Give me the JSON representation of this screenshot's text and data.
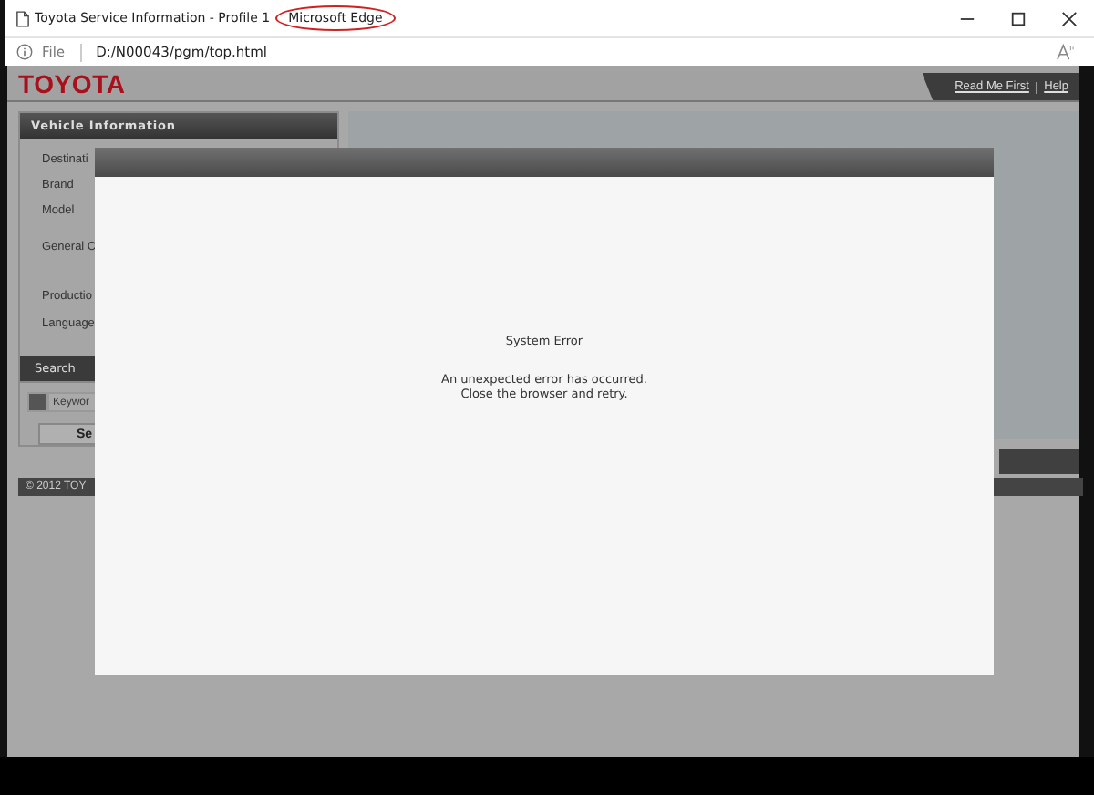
{
  "window": {
    "title": "Toyota Service Information - Profile 1",
    "app_name": "Microsoft Edge",
    "app_name_circled": true
  },
  "address_bar": {
    "scheme": "File",
    "url": "D:/N00043/pgm/top.html"
  },
  "header": {
    "logo": "TOYOTA",
    "links": [
      {
        "label": "Read Me First"
      },
      {
        "label": "Help"
      }
    ],
    "separator": "|"
  },
  "vehicle_panel": {
    "title": "Vehicle Information",
    "fields": [
      "Destinati",
      "Brand",
      "Model",
      "General C",
      "Productio",
      "Language"
    ]
  },
  "search": {
    "tab": "Search",
    "checked": false,
    "placeholder": "Keywor",
    "button": "Se"
  },
  "footer": {
    "text": "© 2012 TOY"
  },
  "dialog": {
    "title": "System Error",
    "message": [
      "An unexpected error has occurred.",
      "Close the browser and retry."
    ]
  }
}
